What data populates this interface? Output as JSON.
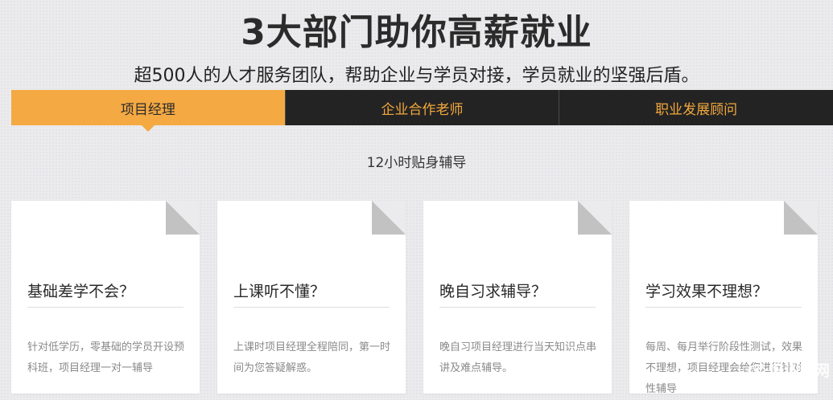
{
  "header": {
    "title": "3大部门助你高薪就业",
    "subtitle": "超500人的人才服务团队，帮助企业与学员对接，学员就业的坚强后盾。"
  },
  "tabs": [
    {
      "label": "项目经理",
      "active": true
    },
    {
      "label": "企业合作老师",
      "active": false
    },
    {
      "label": "职业发展顾问",
      "active": false
    }
  ],
  "tagline": "12小时贴身辅导",
  "cards": [
    {
      "heading": "基础差学不会？",
      "text": "针对低学历，零基础的学员开设预科班，项目经理一对一辅导"
    },
    {
      "heading": "上课听不懂？",
      "text": "上课时项目经理全程陪同，第一时间为您答疑解惑。"
    },
    {
      "heading": "晚自习求辅导？",
      "text": "晚自习项目经理进行当天知识点串讲及难点辅导。"
    },
    {
      "heading": "学习效果不理想？",
      "text": "每周、每月举行阶段性测试，效果不理想，项目经理会给您进行针对性辅导"
    }
  ],
  "watermark": {
    "text": "培训帮网"
  },
  "colors": {
    "accent": "#f4a942",
    "tab_dark": "#232323",
    "tab_text": "#f2a83c"
  }
}
